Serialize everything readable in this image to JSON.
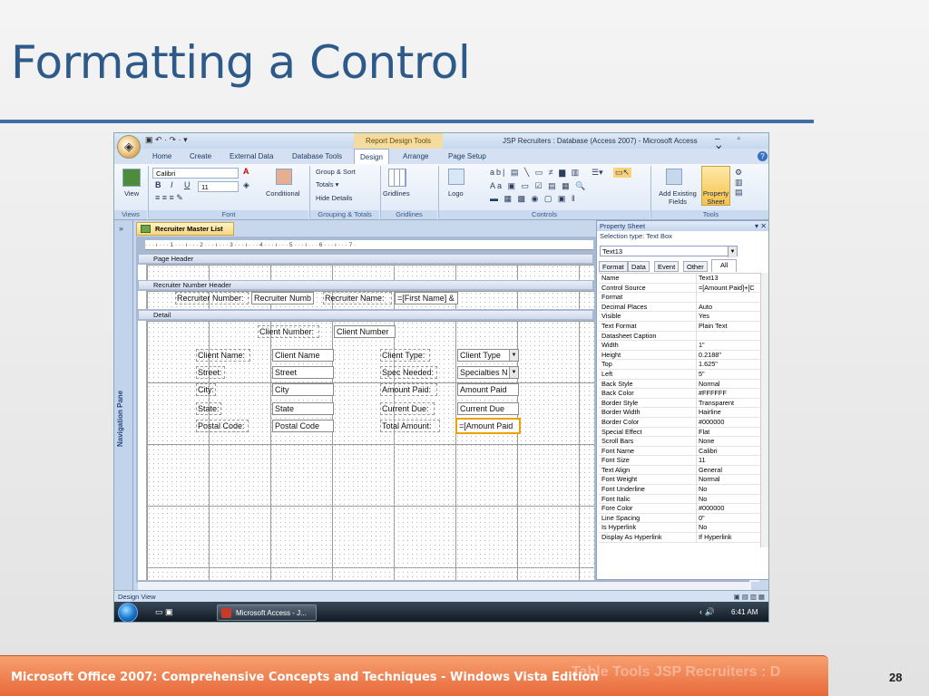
{
  "slide": {
    "title": "Formatting a Control",
    "footer": "Microsoft Office 2007: Comprehensive Concepts and Techniques - Windows Vista Edition",
    "footer_ghost": "Table Tools    JSP Recruiters : D",
    "page_number": "28",
    "colors": {
      "title": "#2e5a8a",
      "rule": "#3f6fa6",
      "footer": "#e8693a"
    }
  },
  "window": {
    "context_tab": "Report Design Tools",
    "title": "JSP Recruiters : Database (Access 2007) - Microsoft Access",
    "qat": "▣ ↶ · ↷ · ▾",
    "controls": "– ▫ ✕",
    "tabs": [
      "Home",
      "Create",
      "External Data",
      "Database Tools",
      "Design",
      "Arrange",
      "Page Setup"
    ],
    "active_tab": "Design"
  },
  "ribbon": {
    "view_label": "View",
    "font_name": "Calibri",
    "font_size": "11",
    "conditional_label": "Conditional",
    "group_sort_label": "Group & Sort",
    "totals_label": "Totals ▾",
    "hide_details_label": "Hide Details",
    "gridlines_label": "Gridlines",
    "logo_label": "Logo",
    "add_fields_label": "Add Existing Fields",
    "property_sheet_label": "Property Sheet",
    "groups": [
      "Views",
      "Font",
      "Grouping & Totals",
      "Gridlines",
      "Controls",
      "Tools"
    ]
  },
  "nav": {
    "label": "Navigation Pane",
    "collapse": "»"
  },
  "report": {
    "tab_name": "Recruiter Master List",
    "ruler": "· · · ı · · · 1 · · · ı · · · 2 · · · ı · · · 3 · · · ı · · · 4 · · · ı · · · 5 · · · ı · · · 6 · · · ı · · · 7 ·",
    "sections": {
      "page_header": "Page Header",
      "group_header": "Recruiter Number Header",
      "detail": "Detail"
    },
    "header_controls": {
      "recruiter_number_label": "Recruiter Number:",
      "recruiter_number_field": "Recruiter Numb",
      "recruiter_name_label": "Recruiter Name:",
      "recruiter_name_field": "=[First Name] &"
    },
    "detail_controls": {
      "client_number_label": "Client Number:",
      "client_number_field": "Client Number",
      "client_name_label": "Client Name:",
      "client_name_field": "Client Name",
      "client_type_label": "Client Type:",
      "client_type_field": "Client Type",
      "street_label": "Street:",
      "street_field": "Street",
      "spec_needed_label": "Spec Needed:",
      "specialties_field": "Specialties N",
      "city_label": "City:",
      "city_field": "City",
      "amount_paid_label": "Amount Paid:",
      "amount_paid_field": "Amount Paid",
      "state_label": "State:",
      "state_field": "State",
      "current_due_label": "Current Due:",
      "current_due_field": "Current Due",
      "postal_code_label": "Postal Code:",
      "postal_code_field": "Postal Code",
      "total_amount_label": "Total Amount:",
      "total_amount_field": "=[Amount Paid"
    }
  },
  "property_sheet": {
    "title": "Property Sheet",
    "selection_type": "Selection type:  Text Box",
    "selected_object": "Text13",
    "tabs": [
      "Format",
      "Data",
      "Event",
      "Other",
      "All"
    ],
    "active_tab": "All",
    "rows": [
      {
        "name": "Name",
        "value": "Text13"
      },
      {
        "name": "Control Source",
        "value": "=[Amount Paid]+[C"
      },
      {
        "name": "Format",
        "value": ""
      },
      {
        "name": "Decimal Places",
        "value": "Auto"
      },
      {
        "name": "Visible",
        "value": "Yes"
      },
      {
        "name": "Text Format",
        "value": "Plain Text"
      },
      {
        "name": "Datasheet Caption",
        "value": ""
      },
      {
        "name": "Width",
        "value": "1\""
      },
      {
        "name": "Height",
        "value": "0.2188\""
      },
      {
        "name": "Top",
        "value": "1.625\""
      },
      {
        "name": "Left",
        "value": "5\""
      },
      {
        "name": "Back Style",
        "value": "Normal"
      },
      {
        "name": "Back Color",
        "value": "#FFFFFF"
      },
      {
        "name": "Border Style",
        "value": "Transparent"
      },
      {
        "name": "Border Width",
        "value": "Hairline"
      },
      {
        "name": "Border Color",
        "value": "#000000"
      },
      {
        "name": "Special Effect",
        "value": "Flat"
      },
      {
        "name": "Scroll Bars",
        "value": "None"
      },
      {
        "name": "Font Name",
        "value": "Calibri"
      },
      {
        "name": "Font Size",
        "value": "11"
      },
      {
        "name": "Text Align",
        "value": "General"
      },
      {
        "name": "Font Weight",
        "value": "Normal"
      },
      {
        "name": "Font Underline",
        "value": "No"
      },
      {
        "name": "Font Italic",
        "value": "No"
      },
      {
        "name": "Fore Color",
        "value": "#000000"
      },
      {
        "name": "Line Spacing",
        "value": "0\""
      },
      {
        "name": "Is Hyperlink",
        "value": "No"
      },
      {
        "name": "Display As Hyperlink",
        "value": "If Hyperlink"
      }
    ]
  },
  "status": {
    "text": "Design View"
  },
  "taskbar": {
    "task": "Microsoft Access - J...",
    "clock": "6:41 AM",
    "tray": "‹ 🔊"
  }
}
